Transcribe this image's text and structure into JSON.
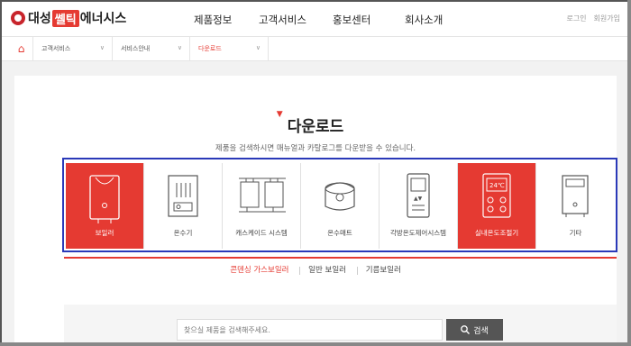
{
  "header": {
    "logo_text_1": "대성",
    "logo_text_cel": "쎌틱",
    "logo_text_2": "에너시스",
    "nav": [
      "제품정보",
      "고객서비스",
      "홍보센터",
      "회사소개"
    ],
    "util": [
      "로그인",
      "회원가입"
    ]
  },
  "breadcrumb": {
    "items": [
      "고객서비스",
      "서비스안내",
      "다운로드"
    ]
  },
  "page": {
    "title": "다운로드",
    "subtitle": "제품을 검색하시면 매뉴얼과 카탈로그를 다운받을 수 있습니다."
  },
  "categories": [
    {
      "label": "보일러",
      "icon": "boiler-icon",
      "active": true
    },
    {
      "label": "온수기",
      "icon": "water-heater-icon",
      "active": false
    },
    {
      "label": "캐스케이드 시스템",
      "icon": "cascade-system-icon",
      "active": false
    },
    {
      "label": "온수매트",
      "icon": "water-mat-icon",
      "active": false
    },
    {
      "label": "각방온도제어시스템",
      "icon": "room-control-icon",
      "active": false
    },
    {
      "label": "실내온도조절기",
      "icon": "thermostat-icon",
      "active": true
    },
    {
      "label": "기타",
      "icon": "etc-icon",
      "active": false
    }
  ],
  "subtabs": [
    "콘덴싱 가스보일러",
    "일반 보일러",
    "기름보일러"
  ],
  "search": {
    "placeholder": "찾으실 제품을 검색해주세요.",
    "button_label": "검색"
  },
  "colors": {
    "accent": "#e53a32",
    "highlight_border": "#2a39b8"
  }
}
